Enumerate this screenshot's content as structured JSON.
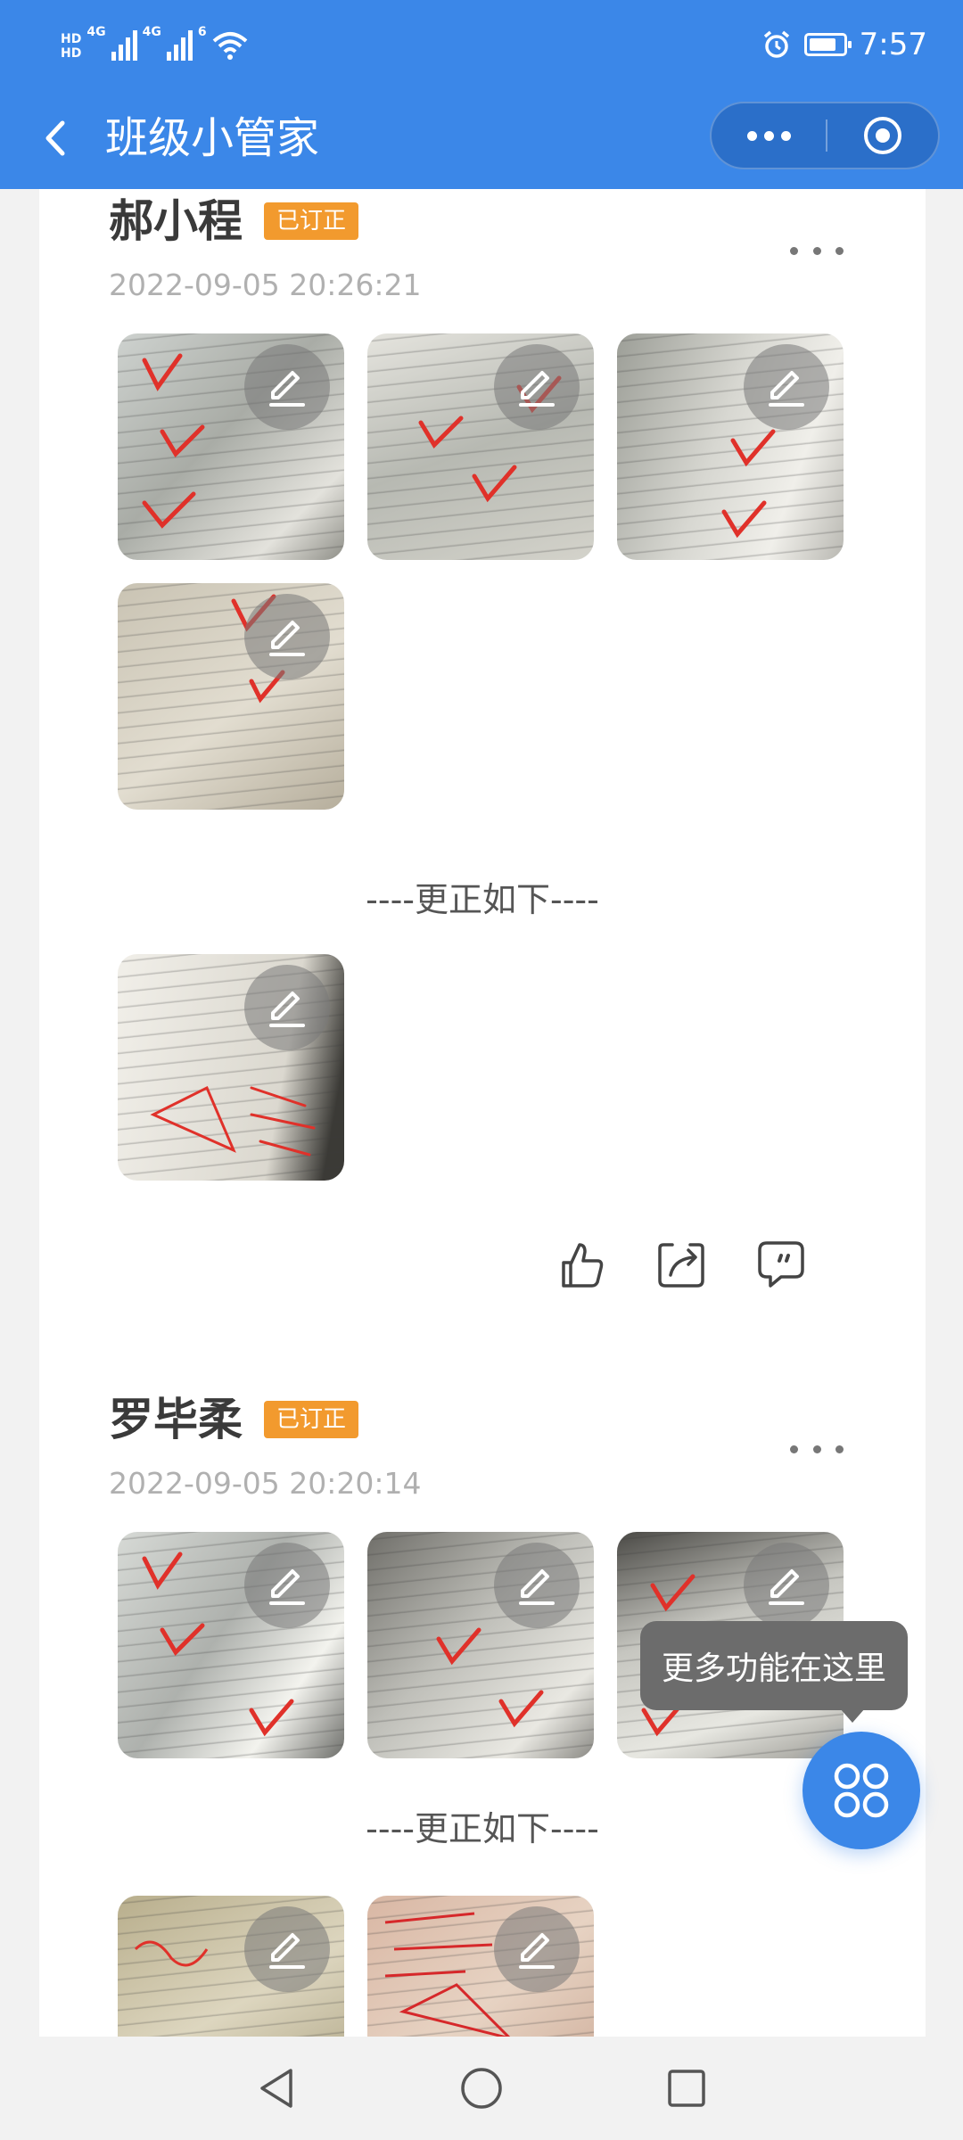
{
  "status_bar": {
    "net1": "HD",
    "net2": "HD",
    "gen1": "4G",
    "gen2": "4G",
    "wifi_gen": "6",
    "time": "7:57",
    "battery_level": 0.8
  },
  "nav": {
    "title": "班级小管家"
  },
  "posts": [
    {
      "name": "郝小程",
      "badge": "已订正",
      "time": "2022-09-05 20:26:21",
      "correction_label": "----更正如下----"
    },
    {
      "name": "罗毕柔",
      "badge": "已订正",
      "time": "2022-09-05 20:20:14",
      "correction_label": "----更正如下----"
    }
  ],
  "tooltip": {
    "text": "更多功能在这里"
  },
  "colors": {
    "primary": "#3b87e8",
    "badge": "#f29a2e",
    "check_mark": "#e0312a"
  },
  "icons": {
    "back": "back-arrow-icon",
    "capsule_more": "more-dots-icon",
    "capsule_close": "target-circle-icon",
    "edit": "pencil-icon",
    "like": "thumbs-up-icon",
    "share": "share-icon",
    "comment": "comment-icon",
    "fab": "grid-menu-icon"
  }
}
